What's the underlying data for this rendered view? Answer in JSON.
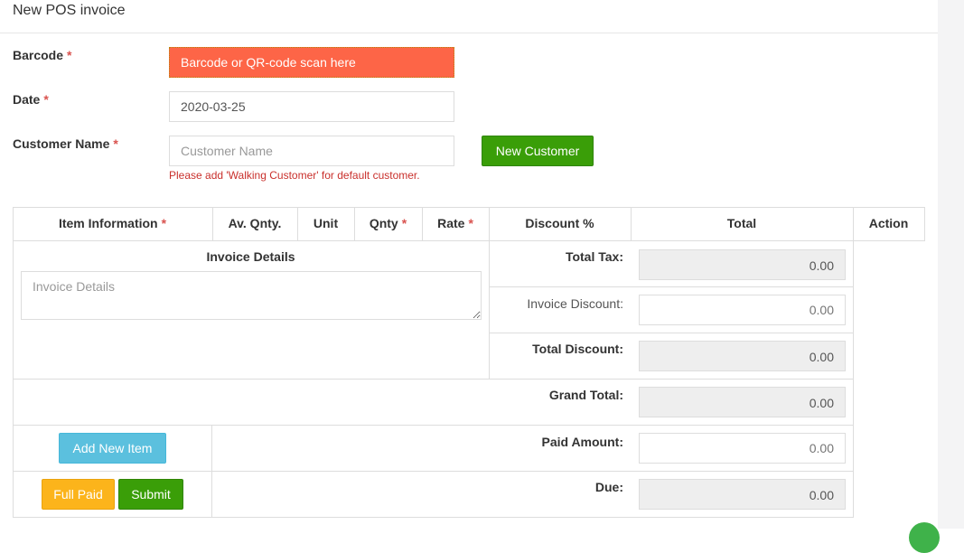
{
  "panel": {
    "title": "New POS invoice"
  },
  "form": {
    "barcode": {
      "label": "Barcode",
      "required_mark": "*",
      "placeholder": "Barcode or QR-code scan here"
    },
    "date": {
      "label": "Date",
      "required_mark": "*",
      "value": "2020-03-25"
    },
    "customer": {
      "label": "Customer Name",
      "required_mark": "*",
      "placeholder": "Customer Name",
      "new_button": "New Customer",
      "hint": "Please add 'Walking Customer' for default customer."
    }
  },
  "table": {
    "headers": [
      {
        "label": "Item Information",
        "required": true
      },
      {
        "label": "Av. Qnty.",
        "required": false
      },
      {
        "label": "Unit",
        "required": false
      },
      {
        "label": "Qnty",
        "required": true
      },
      {
        "label": "Rate",
        "required": true
      },
      {
        "label": "Discount %",
        "required": false
      },
      {
        "label": "Total",
        "required": false
      },
      {
        "label": "Action",
        "required": false
      }
    ],
    "required_mark": "*",
    "invoice_details": {
      "label": "Invoice Details",
      "placeholder": "Invoice Details"
    },
    "totals": {
      "total_tax": {
        "label": "Total Tax:",
        "value": "0.00"
      },
      "invoice_discount": {
        "label": "Invoice Discount:",
        "placeholder": "0.00"
      },
      "total_discount": {
        "label": "Total Discount:",
        "value": "0.00"
      },
      "grand_total": {
        "label": "Grand Total:",
        "value": "0.00"
      },
      "paid_amount": {
        "label": "Paid Amount:",
        "placeholder": "0.00"
      },
      "due": {
        "label": "Due:",
        "value": "0.00"
      }
    },
    "add_item_button": "Add New Item",
    "full_paid_button": "Full Paid",
    "submit_button": "Submit"
  },
  "colors": {
    "barcode_bg": "#fd6547",
    "primary_green": "#3a9e08",
    "info_blue": "#5bc0de",
    "warning_orange": "#fcb41b",
    "required_red": "#d9534f"
  }
}
